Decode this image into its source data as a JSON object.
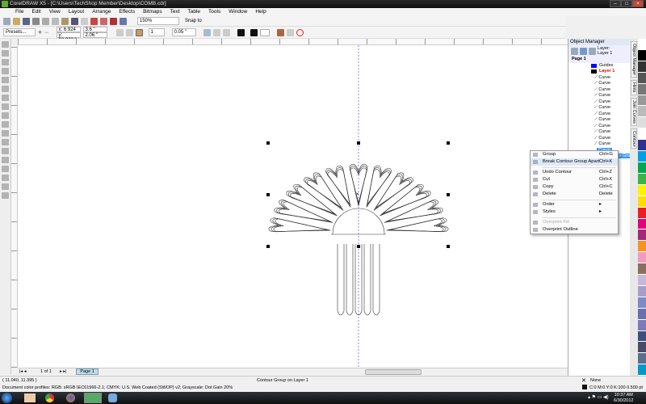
{
  "app": {
    "title": "CorelDRAW X5 - [C:\\Users\\TechShop Member\\Desktop\\COMB.cdr]"
  },
  "menu": [
    "File",
    "Edit",
    "View",
    "Layout",
    "Arrange",
    "Effects",
    "Bitmaps",
    "Text",
    "Table",
    "Tools",
    "Window",
    "Help"
  ],
  "toolbar": {
    "zoom": "150%",
    "snap": "Snap to"
  },
  "propbar": {
    "presets": "Presets...",
    "x": "x: 6.924 \"",
    "y": "y: 10.922 \"",
    "w": "3.6 \"",
    "h": "2.06 \"",
    "steps": "1",
    "offset": "0.05 \""
  },
  "object_manager": {
    "title": "Object Manager",
    "layer_label": "Layer:",
    "layer_value": "Layer 1",
    "page": "Page 1",
    "guides": "Guides",
    "layer": "Layer 1",
    "curves": [
      "Curve",
      "Curve",
      "Curve",
      "Curve",
      "Curve",
      "Curve",
      "Curve",
      "Curve",
      "Curve",
      "Curve",
      "Curve",
      "Curve"
    ],
    "selected": "Curve",
    "selected_sub": "Contour Group"
  },
  "docker_tabs": [
    "Object Manager",
    "Hints",
    "Join Curves",
    "Contour"
  ],
  "context_menu": [
    {
      "label": "Group",
      "shortcut": "Ctrl+G"
    },
    {
      "label": "Break Contour Group Apart",
      "shortcut": "Ctrl+K",
      "highlight": true
    },
    {
      "sep": true
    },
    {
      "label": "Undo Contour",
      "shortcut": "Ctrl+Z"
    },
    {
      "label": "Cut",
      "shortcut": "Ctrl+X"
    },
    {
      "label": "Copy",
      "shortcut": "Ctrl+C"
    },
    {
      "label": "Delete",
      "shortcut": "Delete"
    },
    {
      "sep": true
    },
    {
      "label": "Order",
      "shortcut": "▸"
    },
    {
      "label": "Styles",
      "shortcut": "▸"
    },
    {
      "sep": true
    },
    {
      "label": "Overprint Fill",
      "shortcut": "",
      "disabled": true
    },
    {
      "label": "Overprint Outline",
      "shortcut": ""
    }
  ],
  "page_nav": {
    "count": "1 of 1",
    "tab": "Page 1"
  },
  "status": {
    "coords": "( 11.040, 11.395 )",
    "object": "Contour Group on Layer 1",
    "profiles": "Document color profiles: RGB: sRGB IEC61966-2.1; CMYK: U.S. Web Coated (SWOP) v2; Grayscale: Dot Gain 20%",
    "fill": "None",
    "outline": "C:0 M:0 Y:0 K:100  0.500 pt"
  },
  "clock": {
    "time": "10:37 AM",
    "date": "6/30/2012"
  },
  "palette": [
    "#ffffff",
    "#000000",
    "#333333",
    "#555555",
    "#777777",
    "#999999",
    "#bbbbbb",
    "#dddddd",
    "#ffffff",
    "#2e3192",
    "#00a0e3",
    "#00a651",
    "#39b54a",
    "#fff200",
    "#ffdd00",
    "#ed1c24",
    "#e4007c",
    "#a3287b",
    "#f7941d",
    "#f49ac1",
    "#8b6f5e",
    "#c6b8d9",
    "#a69dca",
    "#7c8ac6",
    "#6a6fb0",
    "#7e7ab8",
    "#3d4f7c",
    "#4a4a6a",
    "#5a6f8f",
    "#0099cc"
  ]
}
